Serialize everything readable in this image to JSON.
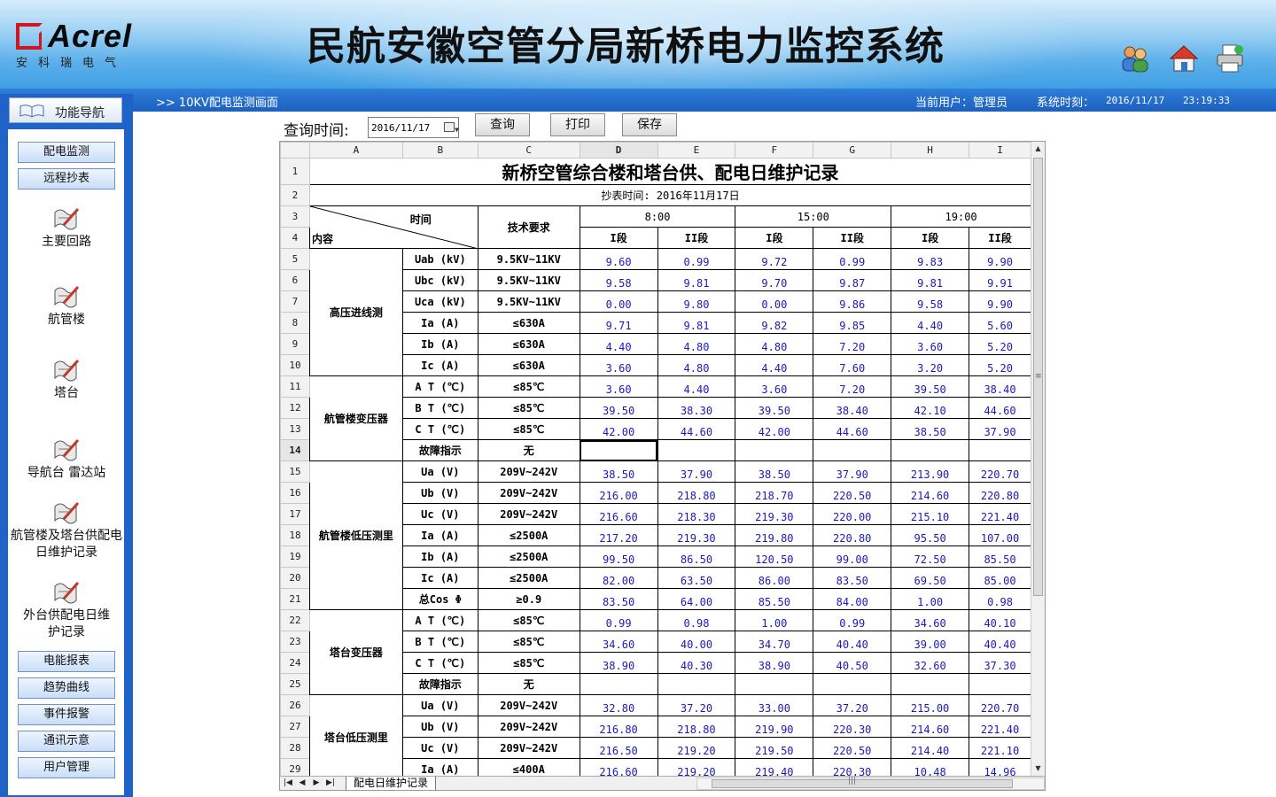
{
  "header": {
    "logo_text": "Acrel",
    "logo_sub": "安科瑞电气",
    "title": "民航安徽空管分局新桥电力监控系统",
    "icons": [
      "users-icon",
      "home-icon",
      "printer-icon"
    ]
  },
  "statusbar": {
    "breadcrumb": ">>  10KV配电监测画面",
    "current_user": "当前用户：管理员",
    "system_time_label": "系统时刻：",
    "system_date": "2016/11/17",
    "system_time": "23:19:33"
  },
  "sidebar": {
    "nav_title": "功能导航",
    "top_buttons": [
      "配电监测",
      "远程抄表"
    ],
    "icon_items": [
      "主要回路",
      "航管楼",
      "塔台",
      "导航台 雷达站",
      "航管楼及塔台供配电日维护记录",
      "外台供配电日维护记录"
    ],
    "bottom_buttons": [
      "电能报表",
      "趋势曲线",
      "事件报警",
      "通讯示意",
      "用户管理"
    ]
  },
  "query": {
    "label": "查询时间:",
    "date": "2016/11/17",
    "buttons": [
      "查询",
      "打印",
      "保存"
    ]
  },
  "sheet": {
    "columns": [
      "A",
      "B",
      "C",
      "D",
      "E",
      "F",
      "G",
      "H",
      "I"
    ],
    "row_numbers": [
      "1",
      "2",
      "3",
      "4",
      "5",
      "6",
      "7",
      "8",
      "9",
      "10",
      "11",
      "12",
      "13",
      "14",
      "15",
      "16",
      "17",
      "18",
      "19",
      "20",
      "21",
      "22",
      "23",
      "24",
      "25",
      "26",
      "27",
      "28",
      "29"
    ],
    "title": "新桥空管综合楼和塔台供、配电日维护记录",
    "subtitle": "抄表时间: 2016年11月17日",
    "header": {
      "time": "时间",
      "content": "内容",
      "tech_req": "技术要求",
      "times": [
        "8:00",
        "15:00",
        "19:00"
      ],
      "segments": [
        "I段",
        "II段",
        "I段",
        "II段",
        "I段",
        "II段"
      ]
    },
    "groups": [
      {
        "name": "高压进线测",
        "rows": [
          {
            "item": "Uab (kV)",
            "req": "9.5KV~11KV",
            "vals": [
              "9.60",
              "0.99",
              "9.72",
              "0.99",
              "9.83",
              "9.90"
            ]
          },
          {
            "item": "Ubc (kV)",
            "req": "9.5KV~11KV",
            "vals": [
              "9.58",
              "9.81",
              "9.70",
              "9.87",
              "9.81",
              "9.91"
            ]
          },
          {
            "item": "Uca (kV)",
            "req": "9.5KV~11KV",
            "vals": [
              "0.00",
              "9.80",
              "0.00",
              "9.86",
              "9.58",
              "9.90"
            ]
          },
          {
            "item": "Ia (A)",
            "req": "≤630A",
            "vals": [
              "9.71",
              "9.81",
              "9.82",
              "9.85",
              "4.40",
              "5.60"
            ]
          },
          {
            "item": "Ib (A)",
            "req": "≤630A",
            "vals": [
              "4.40",
              "4.80",
              "4.80",
              "7.20",
              "3.60",
              "5.20"
            ]
          },
          {
            "item": "Ic (A)",
            "req": "≤630A",
            "vals": [
              "3.60",
              "4.80",
              "4.40",
              "7.60",
              "3.20",
              "5.20"
            ]
          }
        ]
      },
      {
        "name": "航管楼变压器",
        "rows": [
          {
            "item": "A T (℃)",
            "req": "≤85℃",
            "vals": [
              "3.60",
              "4.40",
              "3.60",
              "7.20",
              "39.50",
              "38.40"
            ]
          },
          {
            "item": "B T (℃)",
            "req": "≤85℃",
            "vals": [
              "39.50",
              "38.30",
              "39.50",
              "38.40",
              "42.10",
              "44.60"
            ]
          },
          {
            "item": "C T (℃)",
            "req": "≤85℃",
            "vals": [
              "42.00",
              "44.60",
              "42.00",
              "44.60",
              "38.50",
              "37.90"
            ]
          },
          {
            "item": "故障指示",
            "req": "无",
            "vals": [
              "",
              "",
              "",
              "",
              "",
              ""
            ]
          }
        ]
      },
      {
        "name": "航管楼低压测里",
        "rows": [
          {
            "item": "Ua (V)",
            "req": "209V~242V",
            "vals": [
              "38.50",
              "37.90",
              "38.50",
              "37.90",
              "213.90",
              "220.70"
            ]
          },
          {
            "item": "Ub (V)",
            "req": "209V~242V",
            "vals": [
              "216.00",
              "218.80",
              "218.70",
              "220.50",
              "214.60",
              "220.80"
            ]
          },
          {
            "item": "Uc (V)",
            "req": "209V~242V",
            "vals": [
              "216.60",
              "218.30",
              "219.30",
              "220.00",
              "215.10",
              "221.40"
            ]
          },
          {
            "item": "Ia (A)",
            "req": "≤2500A",
            "vals": [
              "217.20",
              "219.30",
              "219.80",
              "220.80",
              "95.50",
              "107.00"
            ]
          },
          {
            "item": "Ib (A)",
            "req": "≤2500A",
            "vals": [
              "99.50",
              "86.50",
              "120.50",
              "99.00",
              "72.50",
              "85.50"
            ]
          },
          {
            "item": "Ic (A)",
            "req": "≤2500A",
            "vals": [
              "82.00",
              "63.50",
              "86.00",
              "83.50",
              "69.50",
              "85.00"
            ]
          },
          {
            "item": "总Cos Φ",
            "req": "≥0.9",
            "vals": [
              "83.50",
              "64.00",
              "85.50",
              "84.00",
              "1.00",
              "0.98"
            ]
          }
        ]
      },
      {
        "name": "塔台变压器",
        "rows": [
          {
            "item": "A T (℃)",
            "req": "≤85℃",
            "vals": [
              "0.99",
              "0.98",
              "1.00",
              "0.99",
              "34.60",
              "40.10"
            ]
          },
          {
            "item": "B T (℃)",
            "req": "≤85℃",
            "vals": [
              "34.60",
              "40.00",
              "34.70",
              "40.40",
              "39.00",
              "40.40"
            ]
          },
          {
            "item": "C T (℃)",
            "req": "≤85℃",
            "vals": [
              "38.90",
              "40.30",
              "38.90",
              "40.50",
              "32.60",
              "37.30"
            ]
          },
          {
            "item": "故障指示",
            "req": "无",
            "vals": [
              "",
              "",
              "",
              "",
              "",
              ""
            ]
          }
        ]
      },
      {
        "name": "塔台低压测里",
        "rows": [
          {
            "item": "Ua (V)",
            "req": "209V~242V",
            "vals": [
              "32.80",
              "37.20",
              "33.00",
              "37.20",
              "215.00",
              "220.70"
            ]
          },
          {
            "item": "Ub (V)",
            "req": "209V~242V",
            "vals": [
              "216.80",
              "218.80",
              "219.90",
              "220.30",
              "214.60",
              "221.40"
            ]
          },
          {
            "item": "Uc (V)",
            "req": "209V~242V",
            "vals": [
              "216.50",
              "219.20",
              "219.50",
              "220.50",
              "214.40",
              "221.10"
            ]
          },
          {
            "item": "Ia (A)",
            "req": "≤400A",
            "vals": [
              "216.60",
              "219.20",
              "219.40",
              "220.30",
              "10.48",
              "14.96"
            ]
          }
        ]
      }
    ],
    "selected_row": "14",
    "selected_col": "D",
    "sheet_tab": "配电日维护记录"
  }
}
